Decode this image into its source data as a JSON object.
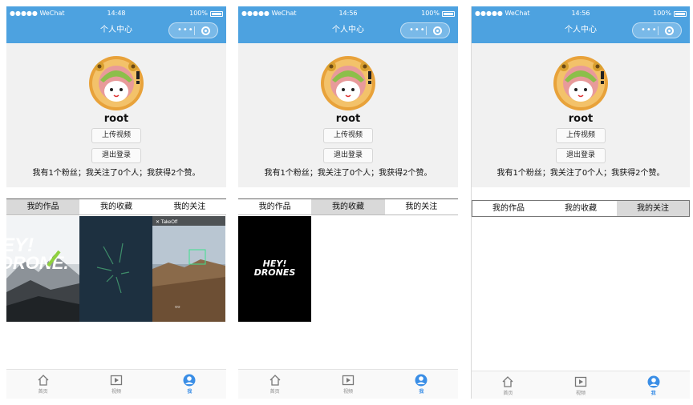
{
  "status": {
    "carrier": "●●●●● WeChat",
    "battery": "100%"
  },
  "screens": [
    {
      "time": "14:48",
      "title": "个人中心",
      "username": "root",
      "upload_label": "上传视频",
      "logout_label": "退出登录",
      "stats": "我有1个粉丝；我关注了0个人；我获得2个赞。",
      "tabs": [
        "我的作品",
        "我的收藏",
        "我的关注"
      ],
      "selected_tab": 0
    },
    {
      "time": "14:56",
      "title": "个人中心",
      "username": "root",
      "upload_label": "上传视频",
      "logout_label": "退出登录",
      "stats": "我有1个粉丝；我关注了0个人；我获得2个赞。",
      "tabs": [
        "我的作品",
        "我的收藏",
        "我的关注"
      ],
      "selected_tab": 1
    },
    {
      "time": "14:56",
      "title": "个人中心",
      "username": "root",
      "upload_label": "上传视频",
      "logout_label": "退出登录",
      "stats": "我有1个粉丝；我关注了0个人；我获得2个赞。",
      "tabs": [
        "我的作品",
        "我的收藏",
        "我的关注"
      ],
      "selected_tab": 2
    }
  ],
  "video_text": {
    "hey": "HEY!",
    "drones": "DRONES"
  },
  "tabbar": [
    {
      "label": "首页",
      "icon": "home-icon"
    },
    {
      "label": "视频",
      "icon": "video-icon"
    },
    {
      "label": "我",
      "icon": "user-icon"
    }
  ],
  "colors": {
    "nav_blue": "#4da2e0",
    "active_tab": "#3a8ee6",
    "selected_tab_bg": "#d9d9d9"
  }
}
